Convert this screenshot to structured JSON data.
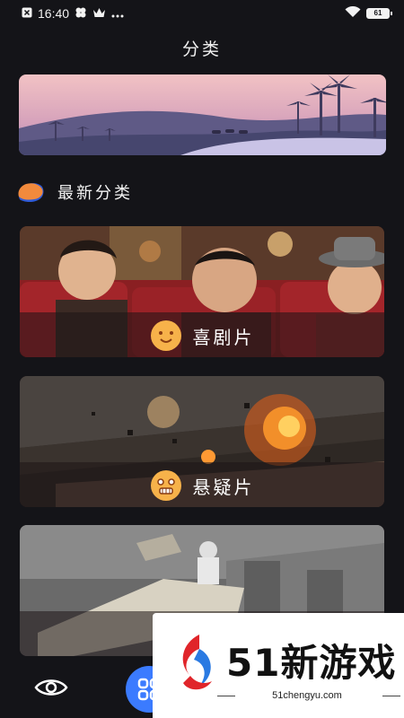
{
  "status_bar": {
    "time": "16:40",
    "battery": "61",
    "icons": [
      "close-box-icon",
      "clover-icon",
      "crown-icon",
      "more-dots-icon",
      "wifi-icon",
      "battery-icon"
    ]
  },
  "header": {
    "title": "分类"
  },
  "section": {
    "title": "最新分类",
    "icon": "chat-bubble-icon"
  },
  "categories": [
    {
      "label": "喜剧片",
      "icon": "smiling-face-icon"
    },
    {
      "label": "悬疑片",
      "icon": "nervous-face-icon"
    },
    {
      "label": "",
      "icon": "category-face-icon"
    }
  ],
  "watermark": {
    "text": "51新游戏",
    "url": "51chengyu.com"
  },
  "colors": {
    "background": "#141418",
    "accent": "#3b7bff",
    "emoji": "#f7b24a"
  }
}
